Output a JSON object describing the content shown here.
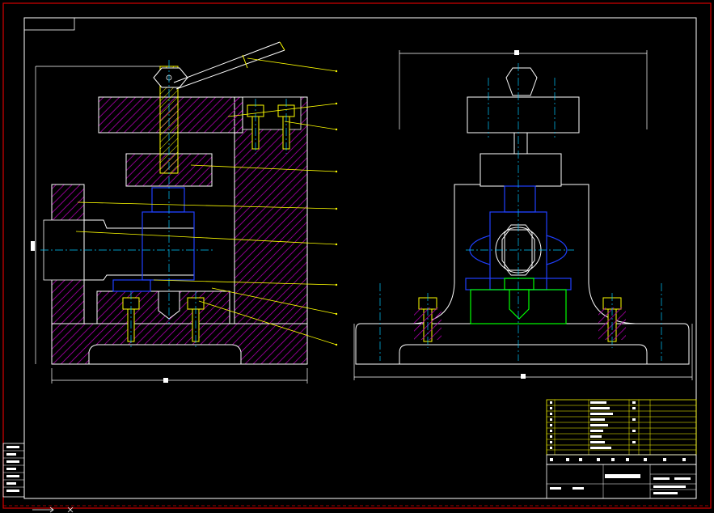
{
  "colors": {
    "background": "#000000",
    "border": "#d40000",
    "outline": "#ffffff",
    "hatch": "#b000b0",
    "pin": "#ffff00",
    "leader": "#ffff00",
    "center": "#00c8ff",
    "part_blue": "#2040ff",
    "part_green": "#00ff00",
    "table_line": "#ffff00"
  },
  "drawing": {
    "front_view_dim": "",
    "side_view_dim": "",
    "left_dim": ""
  },
  "title_block": {
    "title": "",
    "parts_list_rows": 12
  }
}
